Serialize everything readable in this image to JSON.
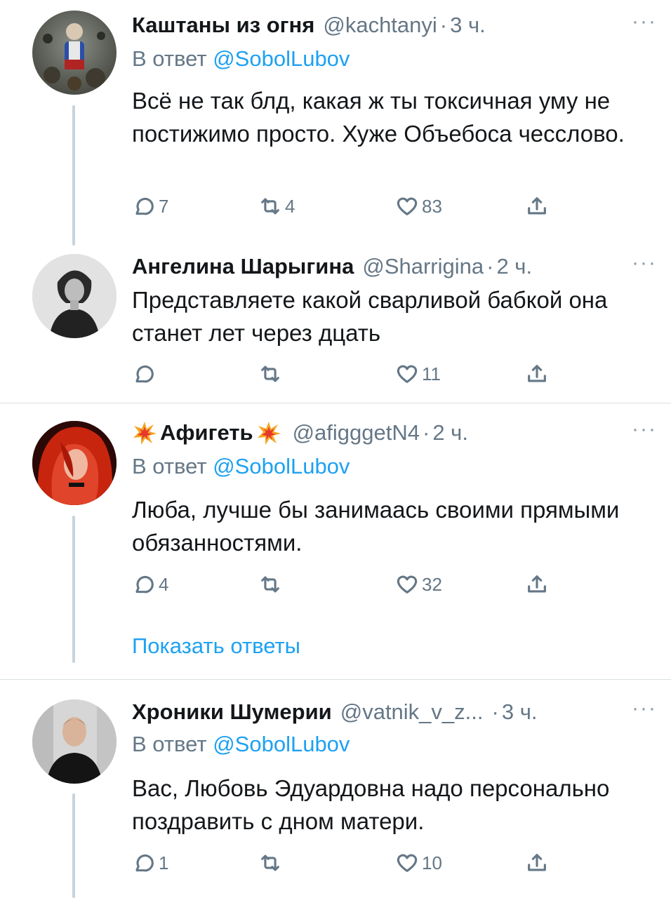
{
  "tweets": [
    {
      "name": "Каштаны из огня",
      "handle": "@kachtanyi",
      "separator": "·",
      "time": "3 ч.",
      "more": "···",
      "reply_prefix": "В ответ",
      "reply_mention": "@SobolLubov",
      "text": "Всё не так блд, какая ж ты токсичная уму не постижимо просто. Хуже Объебоса чесслово.",
      "replies": "7",
      "retweets": "4",
      "likes": "83"
    },
    {
      "name": "Ангелина Шарыгина",
      "handle": "@Sharrigina",
      "separator": "·",
      "time": "2 ч.",
      "more": "···",
      "text": "Представляете какой сварливой бабкой она станет лет через дцать",
      "replies": "",
      "retweets": "",
      "likes": "11"
    },
    {
      "name": "Афигеть",
      "handle": "@afigggetN4",
      "separator": "·",
      "time": "2 ч.",
      "more": "···",
      "reply_prefix": "В ответ",
      "reply_mention": "@SobolLubov",
      "text": "Люба, лучше бы занимаась своими прямыми обязанностями.",
      "replies": "4",
      "retweets": "",
      "likes": "32"
    },
    {
      "name": "Хроники Шумерии",
      "handle": "@vatnik_v_z...",
      "separator": "·",
      "time": "3 ч.",
      "more": "···",
      "reply_prefix": "В ответ",
      "reply_mention": "@SobolLubov",
      "text": "Вас, Любовь Эдуардовна надо персонально поздравить с дном матери.",
      "replies": "1",
      "retweets": "",
      "likes": "10"
    }
  ],
  "show_replies_label": "Показать ответы",
  "colors": {
    "accent": "#1da1f2",
    "secondary_text": "#657786",
    "thread_line": "#c7d4dc"
  }
}
